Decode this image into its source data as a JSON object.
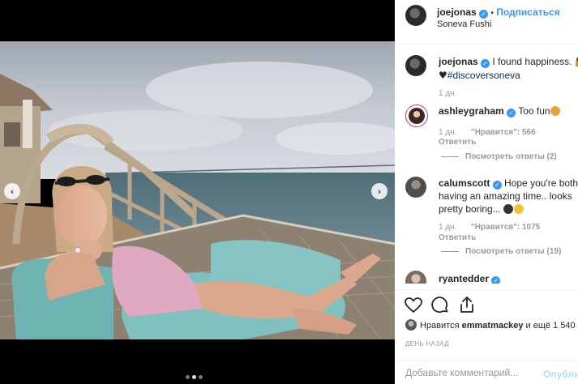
{
  "post": {
    "author": "joejonas",
    "follow_label": "Подписаться",
    "separator": "•",
    "location": "Soneva Fushi"
  },
  "caption": {
    "author": "joejonas",
    "text_line1": "I found happiness. ",
    "hashtag": "#discoversoneva",
    "time": "1 дн."
  },
  "comments": [
    {
      "author": "ashleygraham",
      "text": "Too fun",
      "time": "1 дн.",
      "likes": "\"Нравится\": 566",
      "reply_label": "Ответить",
      "view_replies": "Посмотреть ответы (2)"
    },
    {
      "author": "calumscott",
      "text_line1": "Hope you're both",
      "text_line2": "having an amazing time.. looks",
      "text_line3": "pretty boring...",
      "time": "1 дн.",
      "likes": "\"Нравится\": 1075",
      "reply_label": "Ответить",
      "view_replies": "Посмотреть ответы (19)"
    },
    {
      "author": "ryantedder"
    }
  ],
  "actions": {
    "like_icon": "heart-icon",
    "comment_icon": "comment-icon",
    "share_icon": "share-icon",
    "liked_by_prefix": "Нравится ",
    "liked_by_user": "emmatmackey",
    "liked_by_suffix": " и ещё 1 540",
    "date": "ДЕНЬ НАЗАД"
  },
  "add_comment": {
    "placeholder": "Добавьте комментарий...",
    "publish_label": "Опубли"
  },
  "colors": {
    "accent": "#3897f0",
    "muted": "#999999",
    "publish_disabled": "#b2dffc"
  }
}
